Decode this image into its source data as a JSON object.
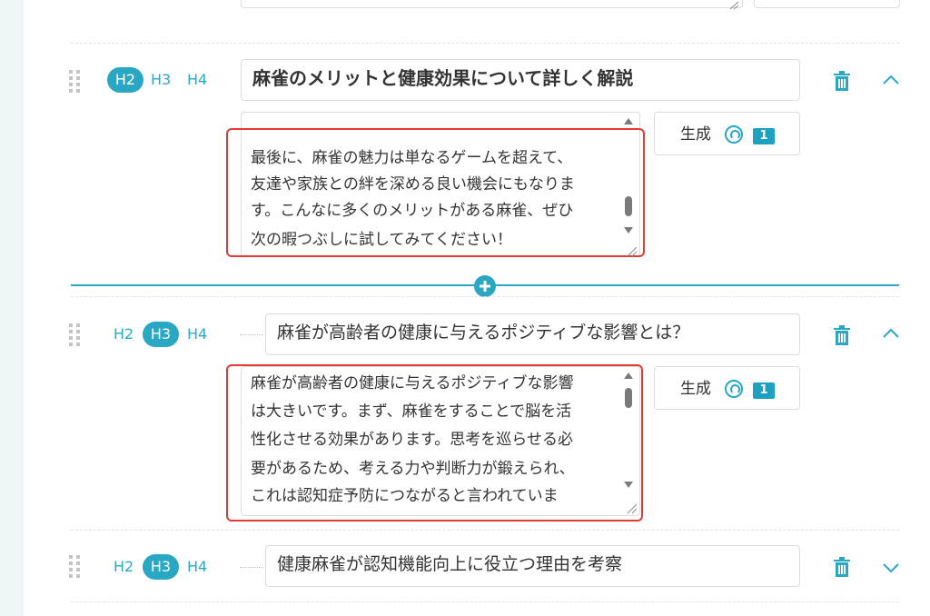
{
  "colors": {
    "accent": "#2aa8c3",
    "highlight": "#e53935"
  },
  "heading_levels": [
    "H2",
    "H3",
    "H4"
  ],
  "blocks": [
    {
      "active_level": "H2",
      "title": "麻雀のメリットと健康効果について詳しく解説",
      "body_lines": [
        "最後に、麻雀の魅力は単なるゲームを超えて、",
        "友達や家族との絆を深める良い機会にもなりま",
        "す。こんなに多くのメリットがある麻雀、ぜひ",
        "次の暇つぶしに試してみてください！"
      ],
      "generate_label": "生成",
      "credit": "1",
      "collapse_icon": "chevron-up-icon"
    },
    {
      "active_level": "H3",
      "title": "麻雀が高齢者の健康に与えるポジティブな影響とは？",
      "body_lines": [
        "麻雀が高齢者の健康に与えるポジティブな影響",
        "は大きいです。まず、麻雀をすることで脳を活",
        "性化させる効果があります。思考を巡らせる必",
        "要があるため、考える力や判断力が鍛えられ、",
        "これは認知症予防につながると言われていま"
      ],
      "generate_label": "生成",
      "credit": "1",
      "collapse_icon": "chevron-up-icon"
    },
    {
      "active_level": "H3",
      "title": "健康麻雀が認知機能向上に役立つ理由を考察",
      "collapse_icon": "chevron-down-icon"
    }
  ],
  "icons": {
    "delete": "trash-icon",
    "insert": "plus-circle-icon",
    "drag": "drag-handle-icon",
    "credit": "coin-icon"
  }
}
